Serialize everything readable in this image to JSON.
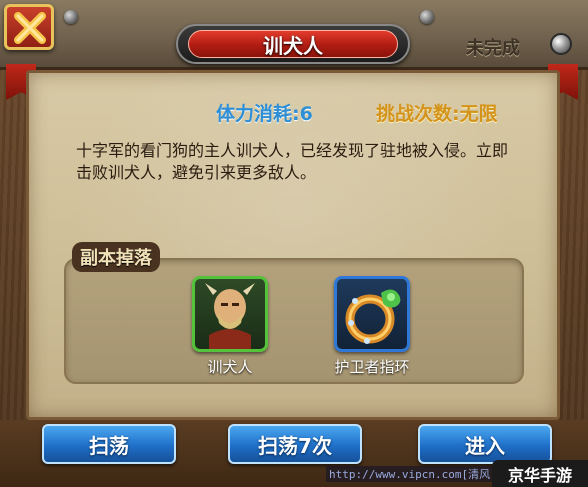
{
  "header": {
    "title": "训犬人",
    "status": "未完成"
  },
  "info": {
    "energy_cost": "体力消耗:6",
    "challenge_count": "挑战次数:无限"
  },
  "description": "十字军的看门狗的主人训犬人，已经发现了驻地被入侵。立即击败训犬人，避免引来更多敌人。",
  "drops": {
    "title": "副本掉落",
    "items": [
      {
        "name": "训犬人",
        "icon": "dog-trainer-portrait-icon",
        "rarity_color": "#54c23a"
      },
      {
        "name": "护卫者指环",
        "icon": "guardian-ring-icon",
        "rarity_color": "#2f78d8"
      }
    ]
  },
  "actions": {
    "sweep": "扫荡",
    "sweep7": "扫荡7次",
    "enter": "进入"
  },
  "watermark": {
    "url": "http://www.vipcn.com[清风",
    "logo": "京华手游"
  },
  "colors": {
    "energy": "#2f8fd6",
    "challenge": "#d4931a",
    "title_red": "#c0281a",
    "button_blue": "#1f6fc8"
  }
}
